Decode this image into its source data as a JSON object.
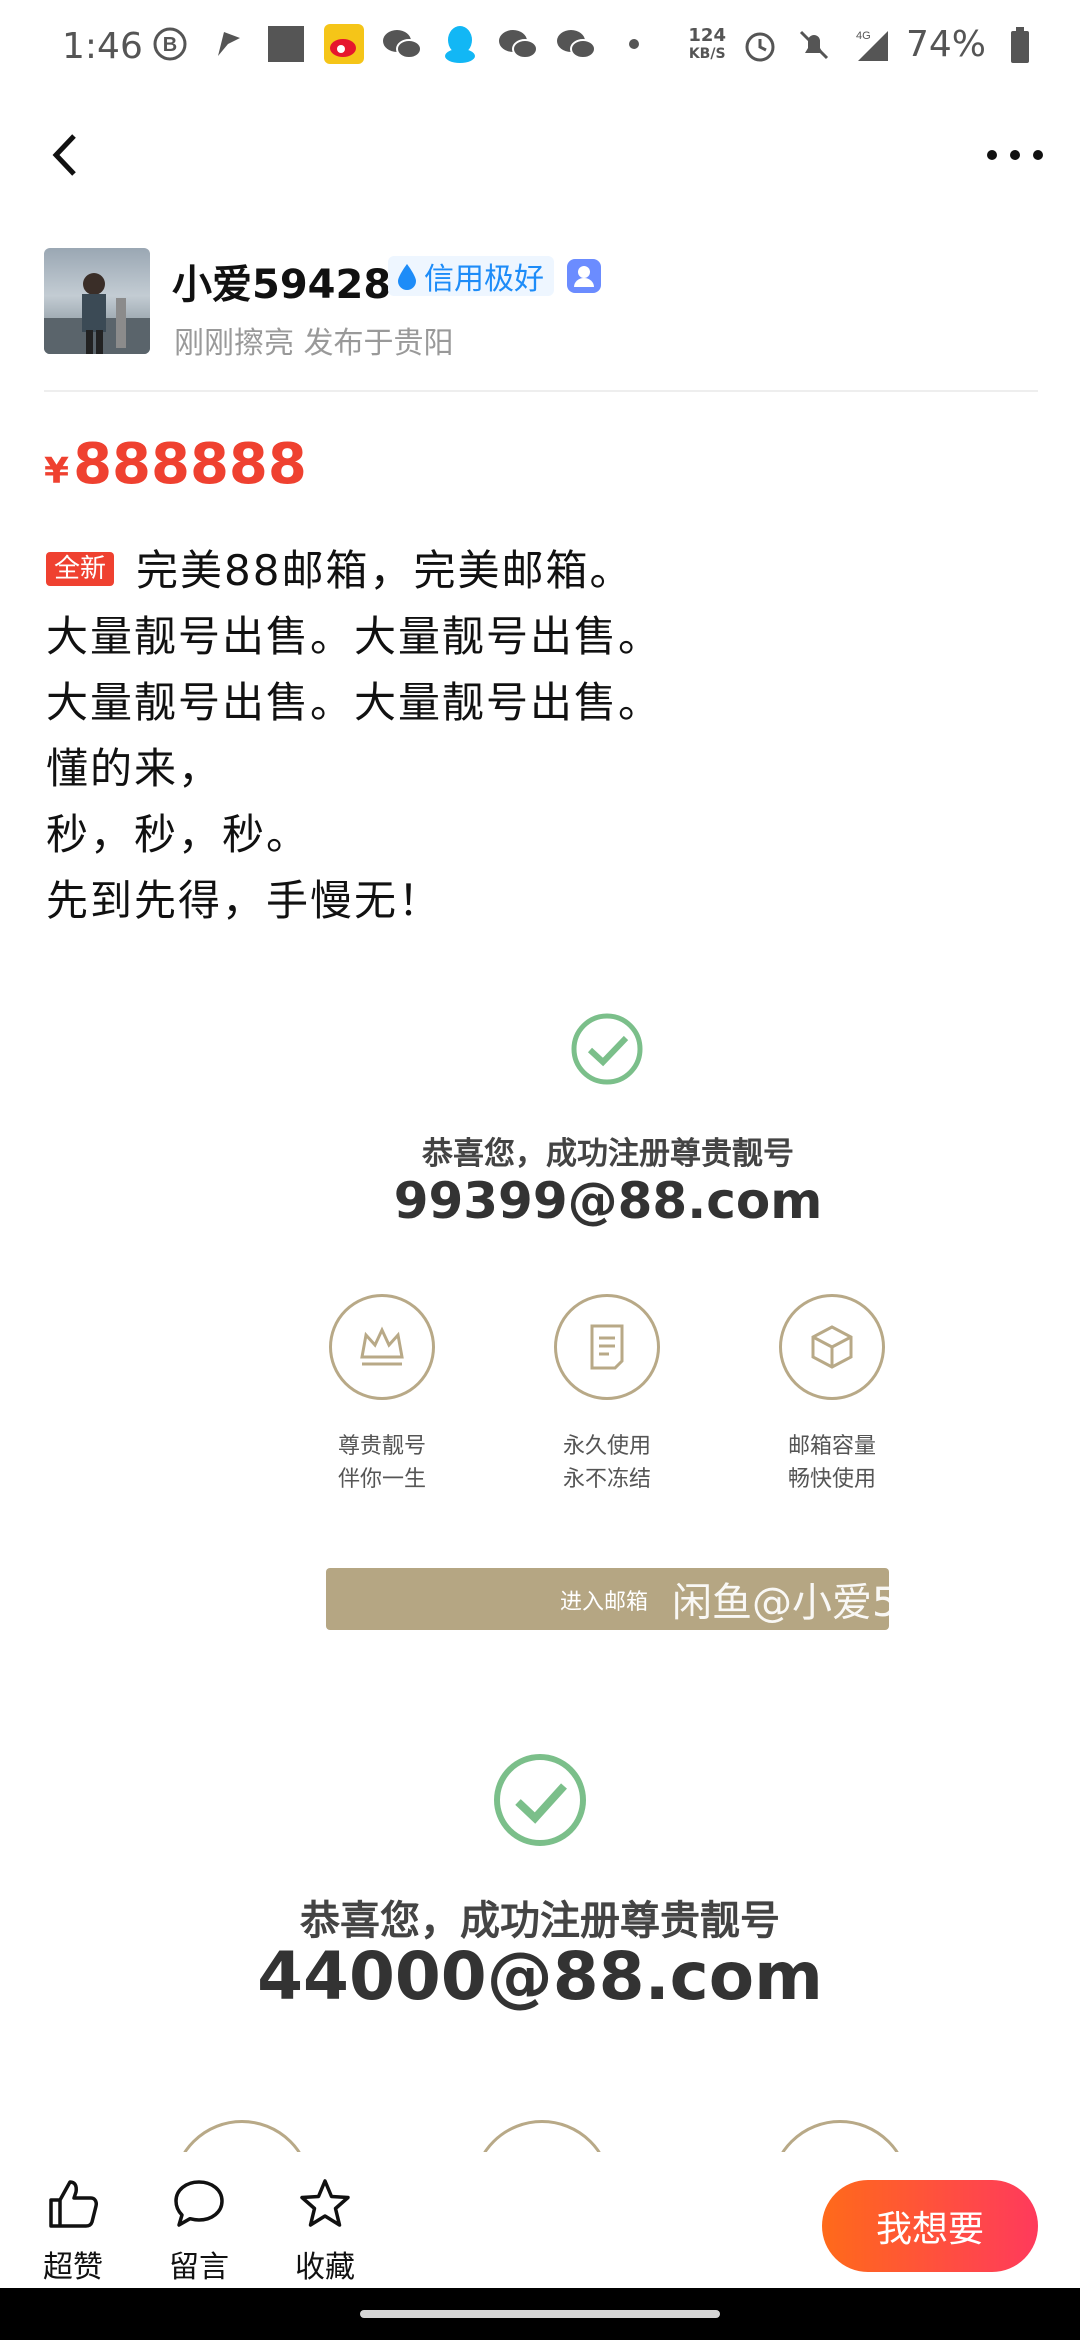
{
  "status_bar": {
    "time": "1:46",
    "net_speed_value": "124",
    "net_speed_unit": "KB/S",
    "network": "4G",
    "battery": "74%",
    "icons": [
      "b-circle-icon",
      "flag-icon",
      "square-icon",
      "weibo-icon",
      "wechat-icon",
      "qq-icon",
      "wechat-icon",
      "wechat-icon",
      "dot-icon",
      "alarm-icon",
      "mute-icon",
      "signal-icon",
      "battery-icon"
    ]
  },
  "nav": {
    "back_icon": "chevron-left-icon",
    "more_icon": "more-dots-icon"
  },
  "seller": {
    "name": "小爱59428",
    "credit": "信用极好",
    "subtitle": "刚刚擦亮 发布于贵阳"
  },
  "listing": {
    "currency": "¥",
    "price": "888888",
    "badge": "全新",
    "lines": [
      "完美88邮箱，完美邮箱。",
      "大量靓号出售。大量靓号出售。",
      "大量靓号出售。大量靓号出售。",
      "懂的来，",
      "秒，秒，秒。",
      "先到先得，手慢无！"
    ]
  },
  "image1": {
    "title": "恭喜您，成功注册尊贵靓号",
    "email": "99399@88.com",
    "features": [
      {
        "line1": "尊贵靓号",
        "line2": "伴你一生",
        "icon": "crown-icon"
      },
      {
        "line1": "永久使用",
        "line2": "永不冻结",
        "icon": "document-icon"
      },
      {
        "line1": "邮箱容量",
        "line2": "畅快使用",
        "icon": "box-icon"
      }
    ],
    "button_label": "进入邮箱",
    "watermark": "闲鱼@小爱5"
  },
  "image2": {
    "title": "恭喜您，成功注册尊贵靓号",
    "email": "44000@88.com"
  },
  "bottom_bar": {
    "like": "超赞",
    "comment": "留言",
    "favorite": "收藏",
    "want": "我想要"
  },
  "colors": {
    "price_red": "#ef4130",
    "credit_blue": "#1d8cf8",
    "gold": "#b5a683",
    "check_green": "#7bbf8a",
    "cta_start": "#ff6a1a",
    "cta_end": "#ff3a5c"
  }
}
